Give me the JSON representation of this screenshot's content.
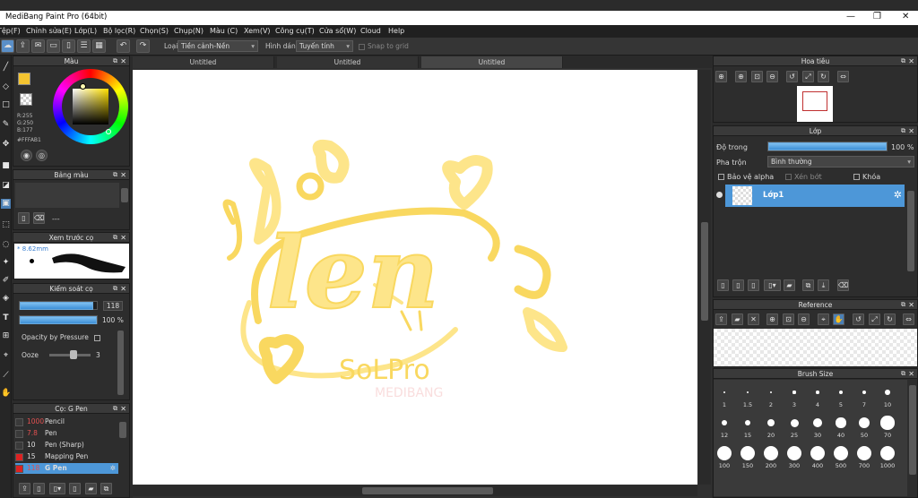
{
  "window": {
    "title": "MediBang Paint Pro (64bit)",
    "minimize": "—",
    "restore": "❐",
    "close": "✕"
  },
  "menu": [
    "Tệp(F)",
    "Chỉnh sửa(E)",
    "Lớp(L)",
    "Bộ lọc(R)",
    "Chọn(S)",
    "Chụp(N)",
    "Màu (C)",
    "Xem(V)",
    "Công cụ(T)",
    "Cửa sổ(W)",
    "Cloud",
    "Help"
  ],
  "toolbar": {
    "type_label": "Loại",
    "type_value": "Tiền cảnh-Nền",
    "shape_label": "Hình dáng",
    "shape_value": "Tuyến tính",
    "snap_label": "Snap to grid"
  },
  "color_panel": {
    "title": "Màu",
    "r": "R:255",
    "g": "G:250",
    "b": "B:177",
    "hex": "#FFFAB1",
    "fg_color": "#FFFAB1",
    "accent": "#f4c430"
  },
  "palette_panel": {
    "title": "Bảng màu",
    "extra": "---"
  },
  "brush_preview": {
    "title": "Xem trước cọ",
    "size": "8.62mm"
  },
  "brush_control": {
    "title": "Kiểm soát cọ",
    "size_value": "118",
    "size_fraction": 0.95,
    "opacity_value": "100 %",
    "opacity_fraction": 1.0,
    "pressure_label": "Opacity by Pressure",
    "ooze_label": "Ooze",
    "ooze_value": "3",
    "ooze_fraction": 0.75
  },
  "brush_list": {
    "title": "Cọ: G Pen",
    "items": [
      {
        "size": "1000",
        "name": "Pencil",
        "color": "#3a3a3a",
        "selected": false,
        "size_red": true
      },
      {
        "size": "7.8",
        "name": "Pen",
        "color": "#3a3a3a",
        "selected": false,
        "size_red": true
      },
      {
        "size": "10",
        "name": "Pen (Sharp)",
        "color": "#3a3a3a",
        "selected": false,
        "size_red": false
      },
      {
        "size": "15",
        "name": "Mapping Pen",
        "color": "#d22",
        "selected": false,
        "size_red": false
      },
      {
        "size": "118",
        "name": "G Pen",
        "color": "#d22",
        "selected": true,
        "size_red": true
      }
    ]
  },
  "tabs": [
    "Untitled",
    "Untitled",
    "Untitled"
  ],
  "canvas": {
    "stroke_color": "#FDE58A",
    "stroke_dark": "#F9D860",
    "text_main": "len",
    "text_sub": "SoLPro",
    "text_faint": "MEDIBANG"
  },
  "navigator": {
    "title": "Hoa tiêu"
  },
  "layer_panel": {
    "title": "Lớp",
    "opacity_label": "Độ trong",
    "opacity_value": "100 %",
    "opacity_fraction": 1.0,
    "blend_label": "Pha trộn",
    "blend_value": "Bình thường",
    "protect_alpha": "Bảo vệ alpha",
    "clip": "Xén bớt",
    "lock": "Khóa",
    "layer_name": "Lớp1"
  },
  "reference_panel": {
    "title": "Reference"
  },
  "brush_size_panel": {
    "title": "Brush Size",
    "sizes": [
      "1",
      "1.5",
      "2",
      "3",
      "4",
      "5",
      "7",
      "10",
      "12",
      "15",
      "20",
      "25",
      "30",
      "40",
      "50",
      "70",
      "100",
      "150",
      "200",
      "300",
      "400",
      "500",
      "700",
      "1000"
    ]
  }
}
